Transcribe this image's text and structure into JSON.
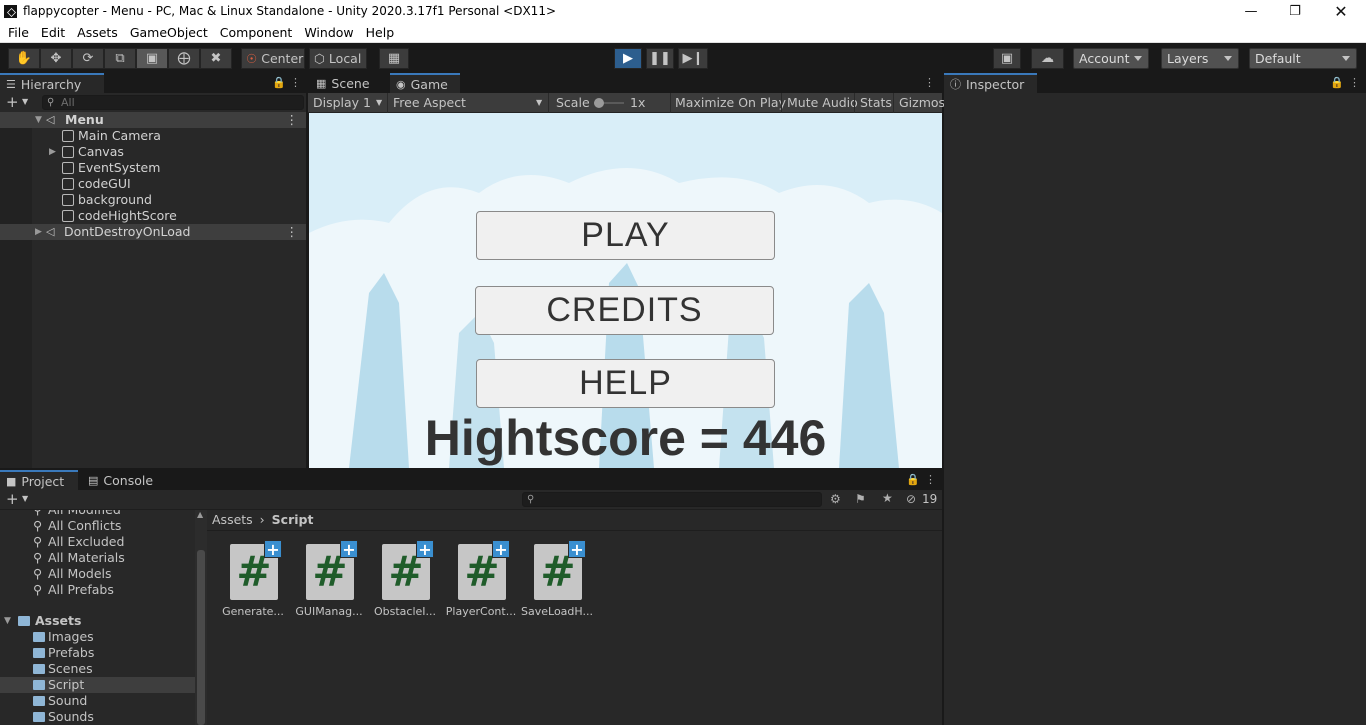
{
  "window": {
    "title": "flappycopter - Menu - PC, Mac & Linux Standalone - Unity 2020.3.17f1 Personal <DX11>"
  },
  "menubar": [
    "File",
    "Edit",
    "Assets",
    "GameObject",
    "Component",
    "Window",
    "Help"
  ],
  "toolbar": {
    "center_label": "Center",
    "local_label": "Local",
    "account_label": "Account",
    "layers_label": "Layers",
    "layout_label": "Default"
  },
  "hierarchy": {
    "tab_label": "Hierarchy",
    "search_placeholder": "All",
    "scene_name": "Menu",
    "items": [
      "Main Camera",
      "Canvas",
      "EventSystem",
      "codeGUI",
      "background",
      "codeHightScore"
    ],
    "dont_destroy_label": "DontDestroyOnLoad"
  },
  "game": {
    "scene_tab": "Scene",
    "game_tab": "Game",
    "display_label": "Display 1",
    "aspect_label": "Free Aspect",
    "scale_label": "Scale",
    "scale_value": "1x",
    "maximize_label": "Maximize On Play",
    "mute_label": "Mute Audio",
    "stats_label": "Stats",
    "gizmos_label": "Gizmos",
    "play_button": "PLAY",
    "credits_button": "CREDITS",
    "help_button": "HELP",
    "highscore_text": "Hightscore = 446"
  },
  "inspector": {
    "tab_label": "Inspector"
  },
  "project": {
    "project_tab": "Project",
    "console_tab": "Console",
    "hidden_count": "19",
    "favorites": [
      "All Modified",
      "All Conflicts",
      "All Excluded",
      "All Materials",
      "All Models",
      "All Prefabs"
    ],
    "assets_root": "Assets",
    "folders": [
      "Images",
      "Prefabs",
      "Scenes",
      "Script",
      "Sound",
      "Sounds"
    ],
    "breadcrumb_root": "Assets",
    "breadcrumb_current": "Script",
    "scripts": [
      "Generate...",
      "GUIManag...",
      "ObstacleI...",
      "PlayerCont...",
      "SaveLoadH..."
    ]
  },
  "colors": {
    "play_active": "#2d5e8e",
    "sky": "#d9eef8",
    "script_icon_hash": "#1f5c2a",
    "selection": "#3e3e3e"
  }
}
